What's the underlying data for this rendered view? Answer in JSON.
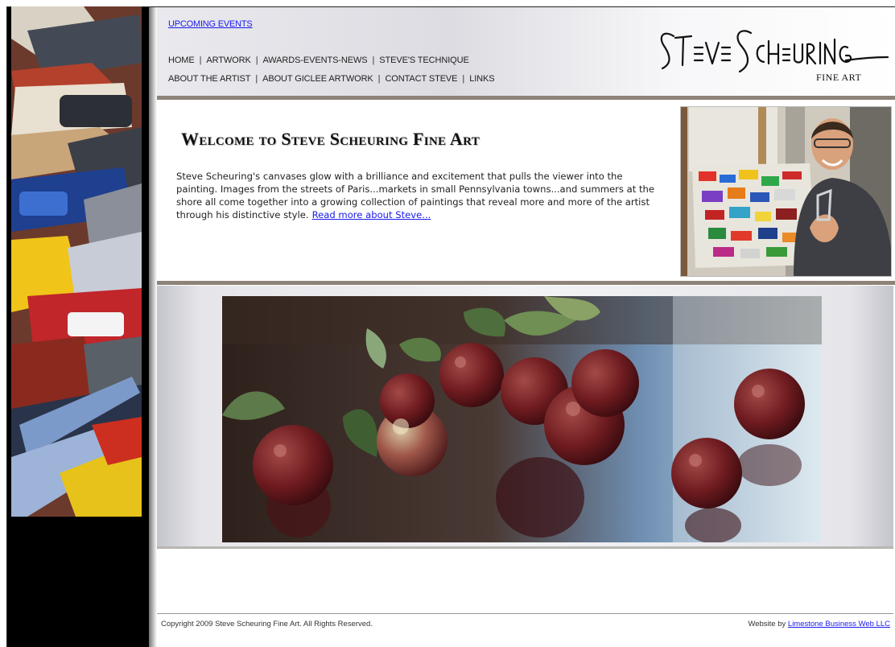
{
  "header": {
    "upcoming_link": "UPCOMING EVENTS",
    "nav_row1": [
      {
        "label": "HOME"
      },
      {
        "label": "ARTWORK"
      },
      {
        "label": "AWARDS-EVENTS-NEWS"
      },
      {
        "label": "STEVE'S TECHNIQUE"
      }
    ],
    "nav_row2": [
      {
        "label": "ABOUT THE ARTIST"
      },
      {
        "label": "ABOUT GICLEE ARTWORK"
      },
      {
        "label": "CONTACT STEVE"
      },
      {
        "label": "LINKS"
      }
    ],
    "separator": "|",
    "logo_main": "STEVE SCHEURING",
    "logo_sub": "FINE ART"
  },
  "welcome": {
    "title": "Welcome to Steve Scheuring Fine Art",
    "body": "Steve Scheuring's canvases glow with a brilliance and excitement that pulls the viewer into the painting.  Images from the streets of Paris...markets in small Pennsylvania towns...and summers at the shore all come together into a growing collection of paintings that reveal more and more of the artist through his distinctive style.",
    "read_more": "Read more about Steve..."
  },
  "footer": {
    "copyright": "Copyright 2009 Steve Scheuring Fine Art.  All Rights Reserved.",
    "credit_prefix": "Website by",
    "credit_link": "Limestone Business Web LLC"
  },
  "colors": {
    "link": "#1a1aee",
    "rule": "#8e8378",
    "left_column": "#000000"
  }
}
